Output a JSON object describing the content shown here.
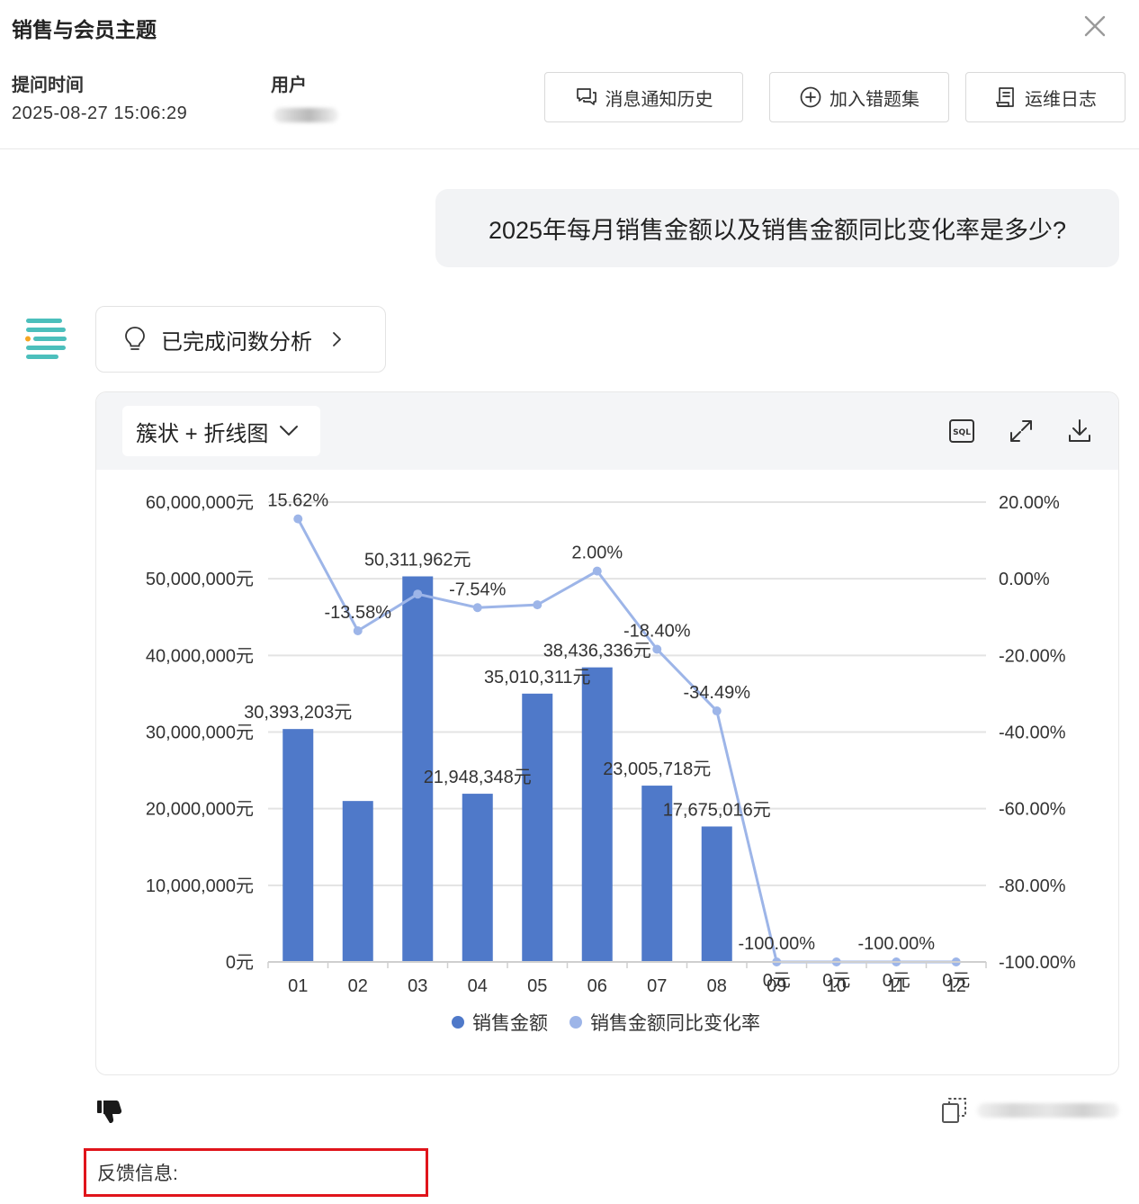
{
  "header": {
    "title": "销售与会员主题",
    "submit_time_label": "提问时间",
    "submit_time_value": "2025-08-27 15:06:29",
    "user_label": "用户",
    "buttons": {
      "notify_history": "消息通知历史",
      "add_error_set": "加入错题集",
      "ops_log": "运维日志"
    },
    "icons": [
      "close-icon",
      "chat-bubbles-icon",
      "plus-circle-icon",
      "log-document-icon"
    ]
  },
  "question": "2025年每月销售金额以及销售金额同比变化率是多少?",
  "analysis": {
    "label": "已完成问数分析",
    "icons": [
      "lightbulb-icon",
      "chevron-right-icon"
    ]
  },
  "chart_panel": {
    "chart_type_select": "簇状 + 折线图",
    "tool_icons": [
      "sql-icon",
      "expand-icon",
      "download-icon"
    ]
  },
  "colors": {
    "bar": "#4f79c9",
    "line": "#9db5e8",
    "grid": "#e3e3e3",
    "accent_logo": "#4cbfbc",
    "logo_dot": "#f5a623",
    "feedback_border": "#e0141b"
  },
  "chart_data": {
    "type": "bar",
    "categories": [
      "01",
      "02",
      "03",
      "04",
      "05",
      "06",
      "07",
      "08",
      "09",
      "10",
      "11",
      "12"
    ],
    "series": [
      {
        "name": "销售金额",
        "type": "bar",
        "axis": "left",
        "values": [
          30393203,
          21000000,
          50311962,
          21948348,
          35010311,
          38436336,
          23005718,
          17675016,
          0,
          0,
          0,
          0
        ],
        "labels": [
          "30,393,203元",
          "",
          "50,311,962元",
          "21,948,348元",
          "35,010,311元",
          "38,436,336元",
          "23,005,718元",
          "17,675,016元",
          "0元",
          "0元",
          "0元",
          "0元"
        ]
      },
      {
        "name": "销售金额同比变化率",
        "type": "line",
        "axis": "right",
        "values": [
          15.62,
          -13.58,
          -4.0,
          -7.54,
          -6.8,
          2.0,
          -18.4,
          -34.49,
          -100,
          -100,
          -100,
          -100
        ],
        "labels": [
          "15.62%",
          "-13.58%",
          "",
          "-7.54%",
          "",
          "2.00%",
          "-18.40%",
          "-34.49%",
          "-100.00%",
          "",
          "-100.00%",
          ""
        ]
      }
    ],
    "y_left": {
      "ylim": [
        0,
        60000000
      ],
      "ticks": [
        "0元",
        "10,000,000元",
        "20,000,000元",
        "30,000,000元",
        "40,000,000元",
        "50,000,000元",
        "60,000,000元"
      ]
    },
    "y_right": {
      "ylim": [
        -100,
        20
      ],
      "ticks": [
        "-100.00%",
        "-80.00%",
        "-60.00%",
        "-40.00%",
        "-20.00%",
        "0.00%",
        "20.00%"
      ]
    },
    "grid": true,
    "legend": "bottom-center"
  },
  "footer": {
    "icons": [
      "thumbs-down-icon",
      "copy-icon"
    ],
    "feedback_label": "反馈信息:"
  }
}
